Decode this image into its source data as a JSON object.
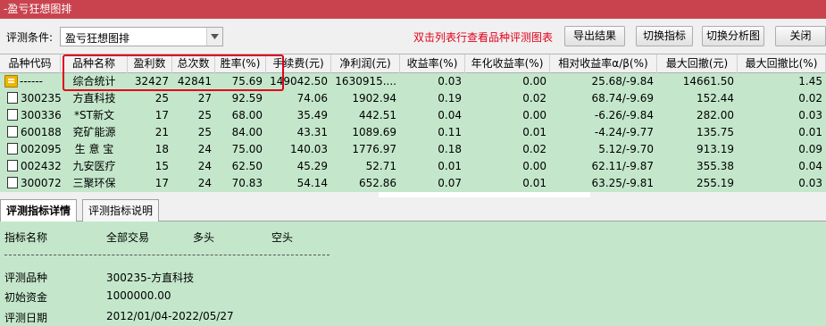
{
  "window": {
    "title": "-盈亏狂想图排"
  },
  "toolbar": {
    "condition_label": "评测条件:",
    "condition_value": "盈亏狂想图排",
    "hint": "双击列表行查看品种评测图表",
    "export_label": "导出结果",
    "switch_indicator_label": "切换指标",
    "switch_chart_label": "切换分析图",
    "close_label": "关闭"
  },
  "table": {
    "columns": [
      "品种代码",
      "品种名称",
      "盈利数",
      "总次数",
      "胜率(%)",
      "手续费(元)",
      "净利润(元)",
      "收益率(%)",
      "年化收益率(%)",
      "相对收益率α/β(%)",
      "最大回撤(元)",
      "最大回撤比(%)"
    ],
    "summary": {
      "code": "------",
      "name": "综合统计",
      "wins": "32427",
      "total": "42841",
      "winrate": "75.69",
      "fee": "149042.50",
      "profit": "1630915....",
      "ret": "0.03",
      "annual": "0.00",
      "relative": "25.68/-9.84",
      "maxdd": "14661.50",
      "maxddp": "1.45"
    },
    "rows": [
      {
        "code": "300235",
        "name": "方直科技",
        "wins": "25",
        "total": "27",
        "winrate": "92.59",
        "fee": "74.06",
        "profit": "1902.94",
        "ret": "0.19",
        "annual": "0.02",
        "relative": "68.74/-9.69",
        "maxdd": "152.44",
        "maxddp": "0.02"
      },
      {
        "code": "300336",
        "name": "*ST新文",
        "wins": "17",
        "total": "25",
        "winrate": "68.00",
        "fee": "35.49",
        "profit": "442.51",
        "ret": "0.04",
        "annual": "0.00",
        "relative": "-6.26/-9.84",
        "maxdd": "282.00",
        "maxddp": "0.03"
      },
      {
        "code": "600188",
        "name": "兖矿能源",
        "wins": "21",
        "total": "25",
        "winrate": "84.00",
        "fee": "43.31",
        "profit": "1089.69",
        "ret": "0.11",
        "annual": "0.01",
        "relative": "-4.24/-9.77",
        "maxdd": "135.75",
        "maxddp": "0.01"
      },
      {
        "code": "002095",
        "name": "生 意 宝",
        "wins": "18",
        "total": "24",
        "winrate": "75.00",
        "fee": "140.03",
        "profit": "1776.97",
        "ret": "0.18",
        "annual": "0.02",
        "relative": "5.12/-9.70",
        "maxdd": "913.19",
        "maxddp": "0.09"
      },
      {
        "code": "002432",
        "name": "九安医疗",
        "wins": "15",
        "total": "24",
        "winrate": "62.50",
        "fee": "45.29",
        "profit": "52.71",
        "ret": "0.01",
        "annual": "0.00",
        "relative": "62.11/-9.87",
        "maxdd": "355.38",
        "maxddp": "0.04"
      },
      {
        "code": "300072",
        "name": "三聚环保",
        "wins": "17",
        "total": "24",
        "winrate": "70.83",
        "fee": "54.14",
        "profit": "652.86",
        "ret": "0.07",
        "annual": "0.01",
        "relative": "63.25/-9.81",
        "maxdd": "255.19",
        "maxddp": "0.03"
      }
    ]
  },
  "tabs": {
    "detail": "评测指标详情",
    "description": "评测指标说明"
  },
  "detail": {
    "header_name": "指标名称",
    "header_all": "全部交易",
    "header_long": "多头",
    "header_short": "空头",
    "symbol_label": "评测品种",
    "symbol_value": "300235-方直科技",
    "capital_label": "初始资金",
    "capital_value": "1000000.00",
    "date_label": "评测日期",
    "date_value": "2012/01/04-2022/05/27"
  },
  "colors": {
    "title_bar": "#c9434e",
    "grid_bg": "#c4e7cb",
    "hint": "#e0001b",
    "highlight_box": "#e0001b"
  }
}
